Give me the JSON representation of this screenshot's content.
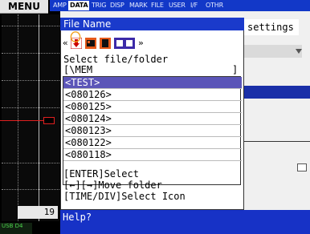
{
  "menu_label": "MENU",
  "tabs": [
    "AMP",
    "DATA",
    "TRIG",
    "DISP",
    "MARK",
    "FILE",
    "USER",
    "I/F",
    "OTHR"
  ],
  "active_tab": "DATA",
  "right_panel": {
    "settings_label": "settings"
  },
  "left_panel": {
    "row_number": "19"
  },
  "status": {
    "usb_label": "USB",
    "drive_label": "D4"
  },
  "dialog": {
    "title": "File Name",
    "prompt": "Select file/folder",
    "path": "[\\MEM",
    "path_close": "]",
    "files": [
      "<TEST>",
      "<080126>",
      "<080125>",
      "<080124>",
      "<080123>",
      "<080122>",
      "<080118>"
    ],
    "selected_index": 0,
    "hints": [
      "[ENTER]Select",
      "[←][→]Move folder",
      "[TIME/DIV]Select Icon"
    ],
    "nav_prev": "«",
    "nav_next": "»"
  },
  "help": {
    "label": "Help?"
  },
  "colors": {
    "title_bar": "#1a3acb",
    "selection": "#5b55b8",
    "highlight_circle": "#f0a020",
    "waveform": "#e02020"
  },
  "icons": [
    "download-icon",
    "memory-icon",
    "file-icon",
    "network-icon"
  ]
}
